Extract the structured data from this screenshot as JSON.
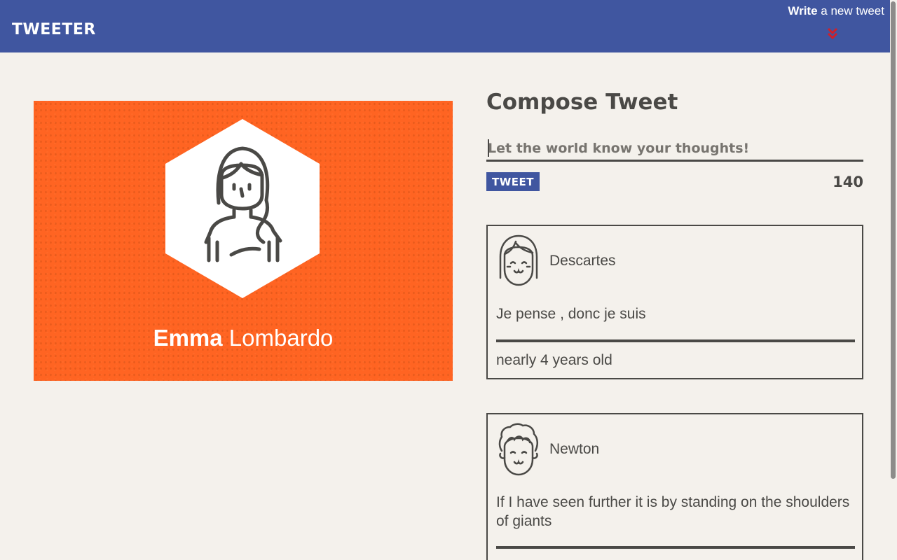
{
  "nav": {
    "brand": "TWEETER",
    "compose_toggle": {
      "bold": "Write",
      "rest": " a new tweet",
      "icon": "double-chevron-down-icon"
    },
    "colors": {
      "bar": "#4056a0",
      "chevron": "#d0202a"
    }
  },
  "profile": {
    "first_name": "Emma",
    "last_name": " Lombardo",
    "avatar_icon": "woman-avatar-icon",
    "background_color": "#ff6422"
  },
  "compose": {
    "title": "Compose Tweet",
    "placeholder": "Let the world know your thoughts!",
    "button_label": "TWEET",
    "char_counter": "140"
  },
  "tweets": [
    {
      "author": "Descartes",
      "avatar_icon": "girl-avatar-icon",
      "text": "Je pense , donc je suis",
      "age": "nearly 4 years old"
    },
    {
      "author": "Newton",
      "avatar_icon": "curly-hair-avatar-icon",
      "text": "If I have seen further it is by standing on the shoulders of giants",
      "age": ""
    }
  ]
}
